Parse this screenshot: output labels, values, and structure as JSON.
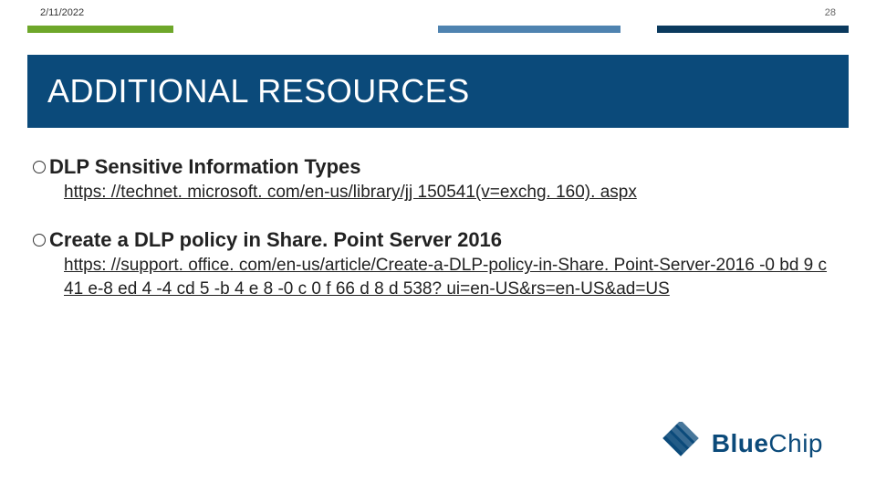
{
  "meta": {
    "date": "2/11/2022",
    "page": "28"
  },
  "title": "ADDITIONAL RESOURCES",
  "items": [
    {
      "title": "DLP Sensitive Information Types",
      "url": "https: //technet. microsoft. com/en-us/library/jj 150541(v=exchg. 160). aspx"
    },
    {
      "title": "Create a DLP policy in Share. Point Server 2016",
      "url": "https: //support. office. com/en-us/article/Create-a-DLP-policy-in-Share. Point-Server-2016 -0 bd 9 c 41 e-8 ed 4 -4 cd 5 -b 4 e 8 -0 c 0 f 66 d 8 d 538? ui=en-US&rs=en-US&ad=US"
    }
  ],
  "brand": {
    "name1": "Blue",
    "name2": "Chip"
  }
}
